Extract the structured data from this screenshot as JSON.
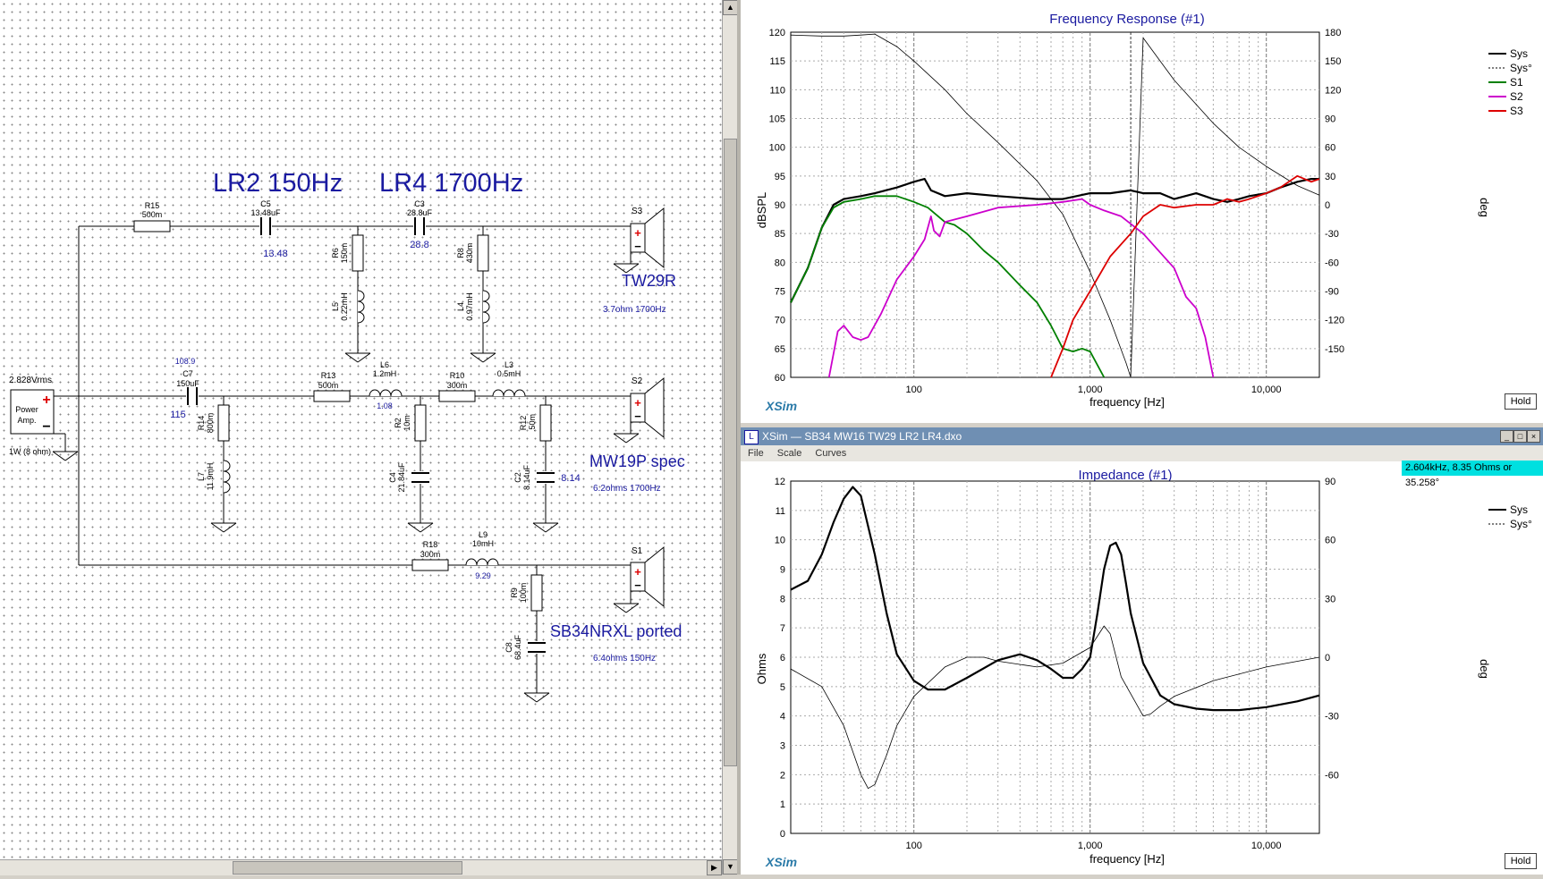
{
  "schematic": {
    "titles": {
      "lr2": "LR2 150Hz",
      "lr4": "LR4 1700Hz"
    },
    "source": {
      "voltage": "2.828Vrms",
      "label1": "Power",
      "label2": "Amp.",
      "power": "1W (8 ohm)"
    },
    "components": {
      "r15_name": "R15",
      "r15_val": "500m",
      "c5_name": "C5",
      "c5_val": "13.48uF",
      "c5_read": "13.48",
      "c3_name": "C3",
      "c3_val": "28.8uF",
      "c3_read": "28.8",
      "r6_name": "R6",
      "r6_val": "150m",
      "l5_name": "L5",
      "l5_val": "0.22mH",
      "r8_name": "R8",
      "r8_val": "430m",
      "l4_name": "L4",
      "l4_val": "0.97mH",
      "c7_name": "C7",
      "c7_val": "150uF",
      "c7_read_top": "108.9",
      "c7_read_bot": "115",
      "r14_name": "R14",
      "r14_val": "800m",
      "l7_name": "L7",
      "l7_val": "11.9mH",
      "r13_name": "R13",
      "r13_val": "500m",
      "l6_name": "L6",
      "l6_val": "1.2mH",
      "l6_read": "1.08",
      "r10_name": "R10",
      "r10_val": "300m",
      "l3_name": "L3",
      "l3_val": "0.5mH",
      "r2_name": "R2",
      "r2_val": "10m",
      "c4_name": "C4",
      "c4_val": "21.84uF",
      "r12_name": "R12",
      "r12_val": ".50m",
      "c2_name": "C2",
      "c2_val": "8.14uF",
      "c2_read": "8.14",
      "r18_name": "R18",
      "r18_val": "300m",
      "l9_name": "L9",
      "l9_val": "10mH",
      "l9_read": "9.29",
      "r9_name": "R9",
      "r9_val": "100m",
      "c8_name": "C8",
      "c8_val": "68.4uF"
    },
    "speakers": [
      {
        "id": "S3",
        "name": "TW29R",
        "spec": "3.7ohm  1700Hz"
      },
      {
        "id": "S2",
        "name": "MW19P spec",
        "spec": "6.2ohms 1700Hz"
      },
      {
        "id": "S1",
        "name": "SB34NRXL ported",
        "spec": "6.4ohms  150Hz"
      }
    ]
  },
  "freq_window": {
    "brand": "XSim",
    "hold_label": "Hold"
  },
  "imp_window": {
    "title": "XSim — SB34 MW16 TW29 LR2 LR4.dxo",
    "menu": [
      "File",
      "Scale",
      "Curves"
    ],
    "cursor_readout": "2.604kHz, 8.35 Ohms or 35.258°",
    "brand": "XSim",
    "hold_label": "Hold",
    "buttons": {
      "min": "_",
      "max": "□",
      "close": "×"
    }
  },
  "chart_data": [
    {
      "type": "line",
      "title": "Frequency Response (#1)",
      "xlabel": "frequency [Hz]",
      "ylabel": "dBSPL",
      "y2label": "deg",
      "xscale": "log",
      "xlim": [
        20,
        20000
      ],
      "ylim": [
        60,
        120
      ],
      "y2lim": [
        -180,
        180
      ],
      "xtick_labels": [
        "100",
        "1,000",
        "10,000"
      ],
      "yticks": [
        60,
        65,
        70,
        75,
        80,
        85,
        90,
        95,
        100,
        105,
        110,
        115,
        120
      ],
      "y2ticks": [
        -150,
        -120,
        -90,
        -60,
        -30,
        0,
        30,
        60,
        90,
        120,
        150,
        180
      ],
      "grid": true,
      "legend": "right",
      "colors": {
        "Sys": "#000000",
        "S1": "#008000",
        "S2": "#cc00cc",
        "S3": "#dd0000"
      },
      "series": [
        {
          "name": "Sys",
          "axis": "left",
          "x": [
            20,
            25,
            30,
            35,
            40,
            50,
            60,
            80,
            100,
            115,
            125,
            150,
            200,
            300,
            500,
            700,
            1000,
            1300,
            1700,
            2000,
            2500,
            3000,
            4000,
            5000,
            6000,
            7000,
            8000,
            10000,
            12000,
            15000,
            18000,
            20000
          ],
          "y": [
            73,
            79,
            86,
            90,
            91,
            91.5,
            92,
            93,
            94,
            94.5,
            92.5,
            91.5,
            92,
            91.5,
            91,
            91,
            92,
            92,
            92.5,
            92,
            92,
            91,
            92,
            91,
            90.5,
            91,
            91.5,
            92,
            93,
            94,
            94.5,
            94.5
          ]
        },
        {
          "name": "Sys°",
          "axis": "right",
          "x": [
            20,
            30,
            40,
            50,
            60,
            80,
            100,
            150,
            200,
            300,
            500,
            700,
            1000,
            1300,
            1600,
            1700,
            2000,
            3000,
            5000,
            7000,
            10000,
            15000,
            20000
          ],
          "y": [
            177,
            176,
            176,
            177,
            178,
            165,
            150,
            120,
            95,
            65,
            25,
            -10,
            -70,
            -120,
            -165,
            -180,
            174,
            130,
            85,
            60,
            40,
            20,
            10
          ]
        },
        {
          "name": "S1",
          "axis": "left",
          "x": [
            20,
            25,
            30,
            35,
            40,
            50,
            60,
            80,
            100,
            120,
            150,
            170,
            200,
            250,
            300,
            400,
            500,
            600,
            700,
            800,
            900,
            1000,
            1200
          ],
          "y": [
            73,
            79,
            86,
            89.5,
            90.5,
            91,
            91.5,
            91.5,
            90.5,
            89.5,
            87,
            86.5,
            85,
            82,
            80,
            76,
            73,
            69,
            65,
            64.5,
            65,
            64.5,
            60
          ]
        },
        {
          "name": "S2",
          "axis": "left",
          "x": [
            33,
            37,
            40,
            45,
            50,
            55,
            65,
            80,
            100,
            115,
            125,
            130,
            140,
            150,
            200,
            300,
            500,
            700,
            900,
            1000,
            1200,
            1500,
            2000,
            3000,
            3500,
            4000,
            4500,
            5000
          ],
          "y": [
            60,
            68,
            69,
            67,
            66.5,
            67,
            71,
            77,
            81,
            84,
            88,
            85.5,
            84.5,
            87,
            88,
            89.5,
            90,
            90.5,
            91,
            90,
            89,
            88,
            85,
            79,
            74,
            72,
            67,
            60
          ]
        },
        {
          "name": "S3",
          "axis": "left",
          "x": [
            600,
            700,
            800,
            1000,
            1300,
            1700,
            2000,
            2500,
            3000,
            4000,
            5000,
            6000,
            7000,
            8000,
            10000,
            12000,
            15000,
            18000,
            20000
          ],
          "y": [
            60,
            65,
            70,
            75,
            81,
            85,
            88,
            90,
            89.5,
            90,
            90,
            91,
            90.5,
            91,
            92,
            93,
            95,
            94,
            94.5
          ]
        }
      ]
    },
    {
      "type": "line",
      "title": "Impedance (#1)",
      "xlabel": "frequency [Hz]",
      "ylabel": "Ohms",
      "y2label": "deg",
      "xscale": "log",
      "xlim": [
        20,
        20000
      ],
      "ylim": [
        0,
        12
      ],
      "y2lim": [
        -90,
        90
      ],
      "xtick_labels": [
        "100",
        "1,000",
        "10,000"
      ],
      "yticks": [
        0,
        1,
        2,
        3,
        4,
        5,
        6,
        7,
        8,
        9,
        10,
        11,
        12
      ],
      "y2ticks": [
        -60,
        -30,
        0,
        30,
        60,
        90
      ],
      "grid": true,
      "legend": "right",
      "series": [
        {
          "name": "Sys",
          "axis": "left",
          "x": [
            20,
            25,
            30,
            35,
            40,
            45,
            50,
            60,
            70,
            80,
            100,
            120,
            150,
            200,
            300,
            400,
            500,
            600,
            700,
            800,
            900,
            1000,
            1100,
            1200,
            1300,
            1400,
            1500,
            1600,
            1700,
            2000,
            2500,
            3000,
            4000,
            5000,
            7000,
            10000,
            15000,
            20000
          ],
          "y": [
            8.3,
            8.6,
            9.5,
            10.6,
            11.4,
            11.8,
            11.5,
            9.5,
            7.5,
            6.1,
            5.2,
            4.9,
            4.9,
            5.3,
            5.9,
            6.1,
            5.9,
            5.6,
            5.3,
            5.3,
            5.6,
            6.0,
            7.5,
            9.0,
            9.8,
            9.9,
            9.5,
            8.5,
            7.5,
            5.8,
            4.7,
            4.4,
            4.25,
            4.2,
            4.2,
            4.3,
            4.5,
            4.7
          ]
        },
        {
          "name": "Sys°",
          "axis": "right",
          "x": [
            20,
            30,
            40,
            50,
            55,
            60,
            70,
            80,
            100,
            150,
            200,
            250,
            300,
            500,
            700,
            1000,
            1200,
            1300,
            1500,
            2000,
            2200,
            2500,
            3000,
            5000,
            10000,
            20000
          ],
          "y": [
            -6,
            -15,
            -35,
            -60,
            -67,
            -65,
            -50,
            -35,
            -20,
            -5,
            0,
            0,
            -2,
            -5,
            -3,
            5,
            16,
            12,
            -10,
            -30,
            -29,
            -25,
            -20,
            -12,
            -5,
            0
          ]
        }
      ]
    }
  ]
}
